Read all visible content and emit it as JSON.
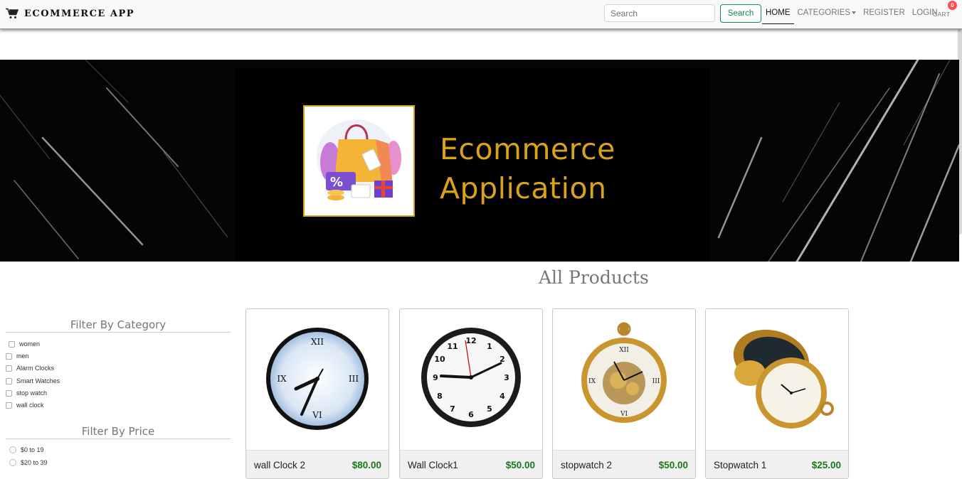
{
  "navbar": {
    "brand": "ECOMMERCE APP",
    "brand_icon": "shopping-cart-icon",
    "search_placeholder": "Search",
    "search_button": "Search",
    "links": {
      "home": "HOME",
      "categories": "CATEGORIES",
      "register": "REGISTER",
      "login": "LOGIN"
    },
    "cart_label": "CART",
    "cart_count": "0"
  },
  "banner": {
    "line1": "Ecommerce",
    "line2": "Application",
    "accent_color": "#d9a21b"
  },
  "main": {
    "title": "All Products"
  },
  "filters": {
    "category_title": "Filter By Category",
    "categories": [
      "women",
      "men",
      "Alarm Clocks",
      "Smart Watches",
      "stop watch",
      "wall clock"
    ],
    "price_title": "Filter By Price",
    "prices": [
      "$0 to 19",
      "$20 to 39"
    ]
  },
  "products": [
    {
      "name": "wall Clock 2",
      "price": "$80.00"
    },
    {
      "name": "Wall Clock1",
      "price": "$50.00"
    },
    {
      "name": "stopwatch 2",
      "price": "$50.00"
    },
    {
      "name": "Stopwatch 1",
      "price": "$25.00"
    }
  ],
  "colors": {
    "price_green": "#1a7a1a",
    "search_green": "#198754",
    "badge_red": "#ff4d4f"
  }
}
